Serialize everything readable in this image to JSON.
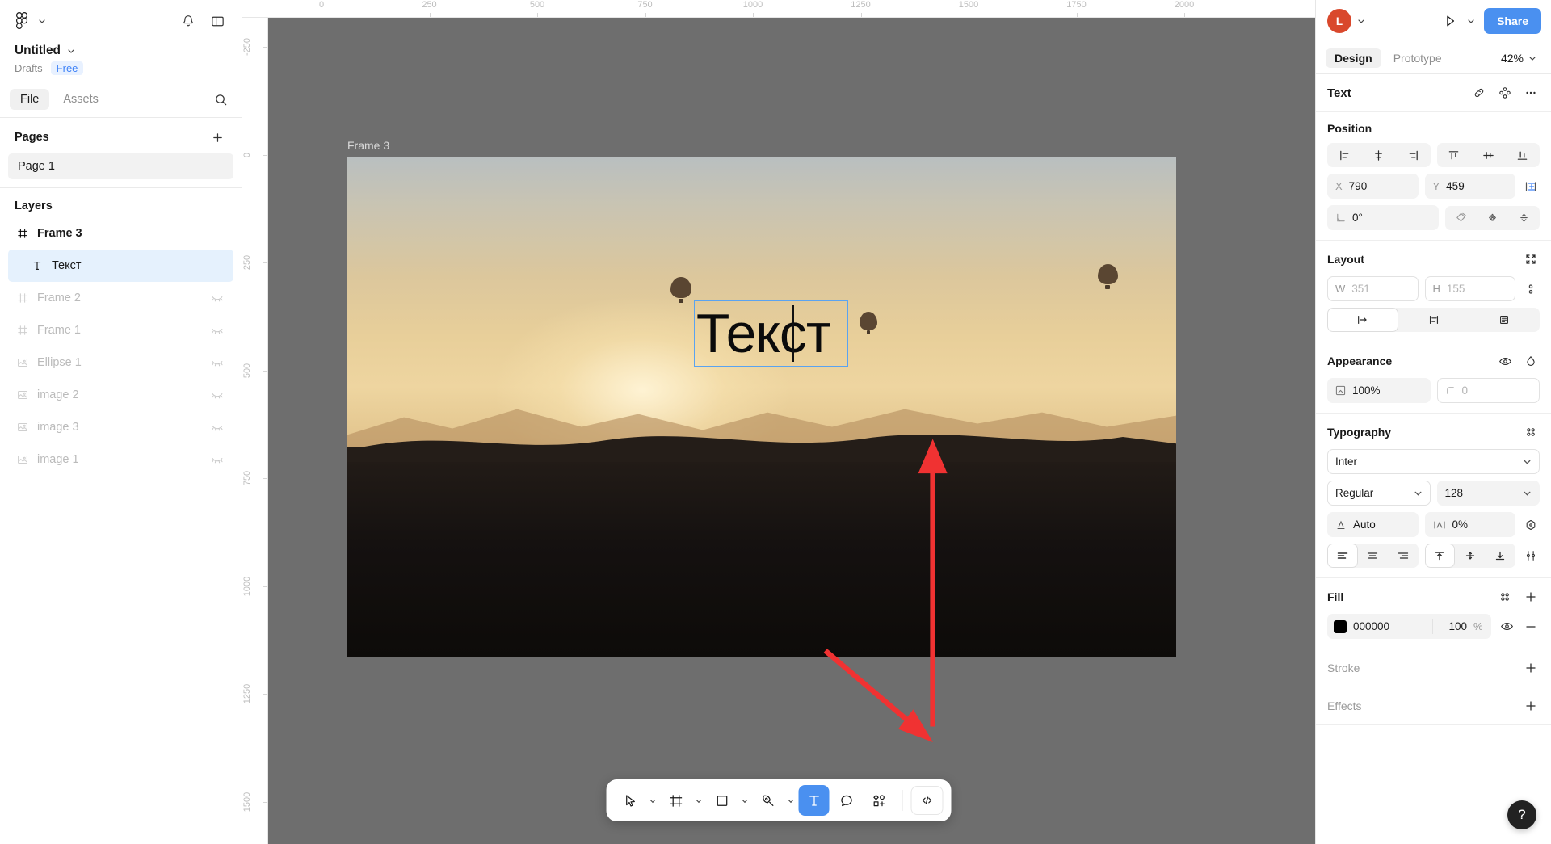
{
  "app": {
    "name": "Figma"
  },
  "sidebar": {
    "logo_icon": "figma-logo-icon",
    "logo_caret_icon": "chevron-down-icon",
    "notifications_icon": "bell-icon",
    "panel_toggle_icon": "sidebar-toggle-icon",
    "file": {
      "title": "Untitled",
      "caret_icon": "chevron-down-icon",
      "location": "Drafts",
      "plan_badge": "Free"
    },
    "tabs": [
      {
        "label": "File",
        "active": true
      },
      {
        "label": "Assets",
        "active": false
      }
    ],
    "search_icon": "search-icon",
    "pages": {
      "title": "Pages",
      "add_icon": "plus-icon",
      "items": [
        {
          "label": "Page 1",
          "active": true
        }
      ]
    },
    "layers": {
      "title": "Layers",
      "items": [
        {
          "label": "Frame 3",
          "icon": "frame-icon",
          "state": "normal",
          "indent": false,
          "selected": false,
          "bold": true,
          "hidden": false
        },
        {
          "label": "Текст",
          "icon": "text-icon",
          "state": "normal",
          "indent": true,
          "selected": true,
          "bold": false,
          "hidden": false
        },
        {
          "label": "Frame 2",
          "icon": "frame-icon",
          "state": "dim",
          "indent": false,
          "selected": false,
          "bold": false,
          "hidden": true
        },
        {
          "label": "Frame 1",
          "icon": "frame-icon",
          "state": "dim",
          "indent": false,
          "selected": false,
          "bold": false,
          "hidden": true
        },
        {
          "label": "Ellipse 1",
          "icon": "image-icon",
          "state": "dim",
          "indent": false,
          "selected": false,
          "bold": false,
          "hidden": true
        },
        {
          "label": "image 2",
          "icon": "image-icon",
          "state": "dim",
          "indent": false,
          "selected": false,
          "bold": false,
          "hidden": true
        },
        {
          "label": "image 3",
          "icon": "image-icon",
          "state": "dim",
          "indent": false,
          "selected": false,
          "bold": false,
          "hidden": true
        },
        {
          "label": "image 1",
          "icon": "image-icon",
          "state": "dim",
          "indent": false,
          "selected": false,
          "bold": false,
          "hidden": true
        }
      ]
    }
  },
  "canvas": {
    "frame_label": "Frame 3",
    "ruler_h_ticks": [
      "0",
      "250",
      "500",
      "750",
      "1000",
      "1250",
      "1500",
      "1750",
      "2000"
    ],
    "ruler_v_ticks": [
      "-250",
      "0",
      "250",
      "500",
      "750",
      "1000",
      "1250",
      "1500"
    ],
    "selected_text": "Текст",
    "annotations": [
      {
        "name": "red-arrow-to-text",
        "color": "#F03232"
      },
      {
        "name": "red-arrow-to-toolbar",
        "color": "#F03232"
      }
    ]
  },
  "toolbar": {
    "items": [
      {
        "name": "move-tool",
        "icon": "cursor-icon",
        "caret": true,
        "active": false
      },
      {
        "name": "frame-tool",
        "icon": "frame-icon",
        "caret": true,
        "active": false
      },
      {
        "name": "shape-tool",
        "icon": "square-icon",
        "caret": true,
        "active": false
      },
      {
        "name": "pen-tool",
        "icon": "pen-icon",
        "caret": true,
        "active": false
      },
      {
        "name": "text-tool",
        "icon": "text-T-icon",
        "caret": false,
        "active": true
      },
      {
        "name": "comment-tool",
        "icon": "comment-icon",
        "caret": false,
        "active": false
      },
      {
        "name": "actions-tool",
        "icon": "plugins-icon",
        "caret": false,
        "active": false
      }
    ],
    "dev_mode_icon": "code-icon"
  },
  "right_panel": {
    "avatar_initial": "L",
    "avatar_caret_icon": "chevron-down-icon",
    "present_icon": "play-icon",
    "present_caret_icon": "chevron-down-icon",
    "share_label": "Share",
    "tabs": [
      {
        "label": "Design",
        "active": true
      },
      {
        "label": "Prototype",
        "active": false
      }
    ],
    "zoom": {
      "value": "42%",
      "caret_icon": "chevron-down-icon"
    },
    "selection": {
      "title": "Text",
      "actions": [
        "link-icon",
        "component-icon",
        "more-icon"
      ]
    },
    "position": {
      "title": "Position",
      "align_h": [
        "align-left-icon",
        "align-horizontal-center-icon",
        "align-right-icon"
      ],
      "align_v": [
        "align-top-icon",
        "align-vertical-center-icon",
        "align-bottom-icon"
      ],
      "x_label": "X",
      "x_value": "790",
      "y_label": "Y",
      "y_value": "459",
      "constraints_icon": "constraints-icon",
      "rotation_label": "rotation-icon",
      "rotation_value": "0°",
      "corner_icon": "corner-radius-icon",
      "flip_h_icon": "flip-horizontal-icon",
      "flip_v_icon": "flip-vertical-icon"
    },
    "layout": {
      "title": "Layout",
      "collapse_icon": "resize-to-fit-icon",
      "w_label": "W",
      "w_value": "351",
      "h_label": "H",
      "h_value": "155",
      "ratio_icon": "lock-aspect-ratio-icon",
      "resize_modes": [
        "auto-width-icon",
        "auto-height-icon",
        "fixed-size-icon"
      ],
      "resize_active_index": 0
    },
    "appearance": {
      "title": "Appearance",
      "visibility_icon": "eye-icon",
      "blend_icon": "blend-mode-icon",
      "opacity_icon": "opacity-icon",
      "opacity_value": "100%",
      "radius_icon": "corner-radius-icon",
      "radius_value": "0"
    },
    "typography": {
      "title": "Typography",
      "settings_icon": "type-settings-icon",
      "font_family": "Inter",
      "font_style": "Regular",
      "font_size": "128",
      "line_height_label": "line-height-icon",
      "line_height_value": "Auto",
      "letter_spacing_label": "letter-spacing-icon",
      "letter_spacing_value": "0%",
      "variable_icon": "type-variable-icon",
      "align_h": [
        "text-align-left-icon",
        "text-align-center-icon",
        "text-align-right-icon"
      ],
      "align_h_active_index": 0,
      "align_v": [
        "text-align-top-icon",
        "text-align-middle-icon",
        "text-align-bottom-icon"
      ],
      "align_v_active_index": 0,
      "detail_icon": "type-details-icon"
    },
    "fill": {
      "title": "Fill",
      "styles_icon": "styles-icon",
      "add_icon": "plus-icon",
      "color_hex": "000000",
      "color_value": "#000000",
      "opacity": "100",
      "opacity_unit": "%",
      "visibility_icon": "eye-icon",
      "remove_icon": "minus-icon"
    },
    "stroke": {
      "title": "Stroke",
      "add_icon": "plus-icon"
    },
    "effects": {
      "title": "Effects",
      "add_icon": "plus-icon"
    },
    "help_label": "?"
  }
}
